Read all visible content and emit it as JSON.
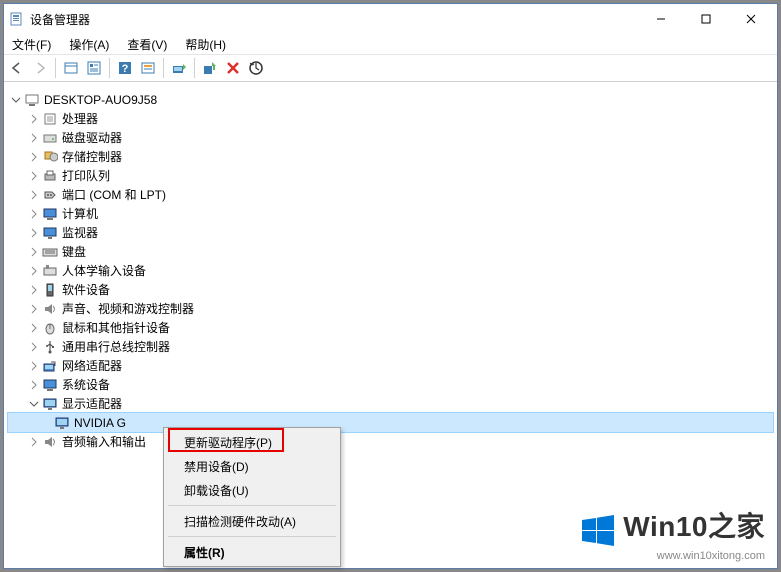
{
  "titlebar": {
    "title": "设备管理器"
  },
  "menubar": {
    "file": "文件(F)",
    "action": "操作(A)",
    "view": "查看(V)",
    "help": "帮助(H)"
  },
  "tree": {
    "root": "DESKTOP-AUO9J58",
    "items": [
      "处理器",
      "磁盘驱动器",
      "存储控制器",
      "打印队列",
      "端口 (COM 和 LPT)",
      "计算机",
      "监视器",
      "键盘",
      "人体学输入设备",
      "软件设备",
      "声音、视频和游戏控制器",
      "鼠标和其他指针设备",
      "通用串行总线控制器",
      "网络适配器",
      "系统设备",
      "显示适配器"
    ],
    "da_child_nvidia": "NVIDIA G",
    "da_child_audio": "音频输入和输出"
  },
  "context_menu": {
    "update": "更新驱动程序(P)",
    "disable": "禁用设备(D)",
    "uninstall": "卸载设备(U)",
    "scan": "扫描检测硬件改动(A)",
    "properties": "属性(R)"
  },
  "watermark": {
    "brand": "Win10之家",
    "url": "www.win10xitong.com"
  }
}
